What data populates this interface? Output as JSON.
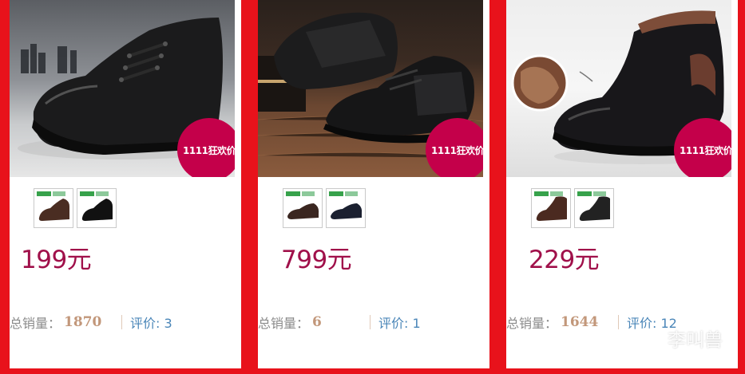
{
  "products": [
    {
      "image": "black-leather-lace-up-shoe-fur-lined",
      "badge": "1111狂欢价",
      "thumbnails": [
        "brown-shoe-thumb",
        "black-shoe-thumb"
      ],
      "price": "199元",
      "sales_label": "总销量：",
      "sales_count": "1870",
      "review_label": "评价: 3"
    },
    {
      "image": "black-leather-casual-shoes-pair",
      "badge": "1111狂欢价",
      "thumbnails": [
        "brown-shoe-thumb",
        "black-shoe-thumb"
      ],
      "price": "799元",
      "sales_label": "总销量：",
      "sales_count": "6",
      "review_label": "评价: 1"
    },
    {
      "image": "black-leather-zip-boot-fur-lined",
      "badge": "1111狂欢价",
      "thumbnails": [
        "brown-shoe-thumb",
        "black-shoe-thumb"
      ],
      "price": "229元",
      "sales_label": "总销量：",
      "sales_count": "1644",
      "review_label": "评价: 12"
    }
  ],
  "watermark": {
    "icon": "wechat-icon",
    "text": "李叫兽"
  },
  "colors": {
    "page_background": "#e8121b",
    "price": "#a0104a",
    "badge": "#c4004a",
    "sales_value": "#c2977a",
    "review_link": "#4a86b8"
  }
}
